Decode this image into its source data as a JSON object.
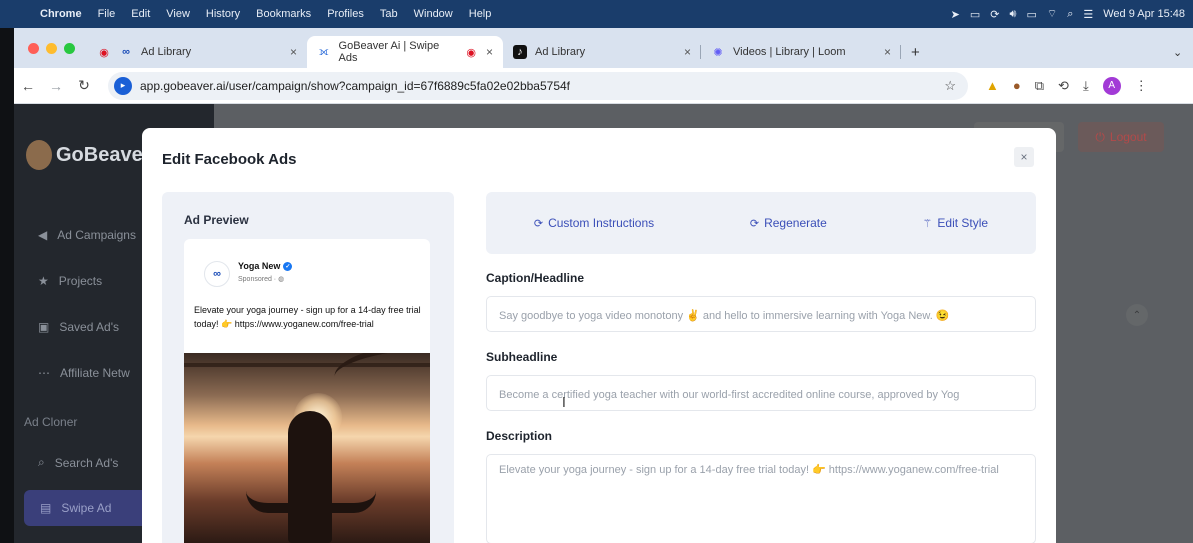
{
  "menubar": {
    "apple_icon": "apple-icon",
    "items": [
      "Chrome",
      "File",
      "Edit",
      "View",
      "History",
      "Bookmarks",
      "Profiles",
      "Tab",
      "Window",
      "Help"
    ],
    "clock": "Wed 9 Apr  15:48"
  },
  "tabs": [
    {
      "label": "Ad Library",
      "icon": "meta-icon"
    },
    {
      "label": "GoBeaver Ai | Swipe Ads",
      "icon": "gobeaver-icon"
    },
    {
      "label": "Ad Library",
      "icon": "tiktok-icon"
    },
    {
      "label": "Videos | Library | Loom",
      "icon": "loom-icon"
    }
  ],
  "address": {
    "url": "app.gobeaver.ai/user/campaign/show?campaign_id=67f6889c5fa02e02bba5754f",
    "avatar_letter": "A"
  },
  "sidebar": {
    "logo": "GoBeave",
    "items": [
      "Ad Campaigns",
      "Projects",
      "Saved Ad's",
      "Affiliate Netw"
    ],
    "section": "Ad Cloner",
    "cloner_items": [
      "Search Ad's",
      "Swipe Ad"
    ]
  },
  "header": {
    "logout": "Logout"
  },
  "modal": {
    "title": "Edit Facebook Ads",
    "close": "×",
    "preview": {
      "title": "Ad Preview",
      "page_name": "Yoga New",
      "sponsored": "Sponsored · ",
      "text": "Elevate your yoga journey - sign up for a 14-day free trial today! 👉 https://www.yoganew.com/free-trial"
    },
    "actions": {
      "custom": "Custom Instructions",
      "regenerate": "Regenerate",
      "edit_style": "Edit Style"
    },
    "fields": {
      "caption_label": "Caption/Headline",
      "caption_value": "Say goodbye to yoga video monotony ✌️ and hello to immersive learning with Yoga New. 😉",
      "sub_label": "Subheadline",
      "sub_value": "Become a certified yoga teacher with our world-first accredited online course, approved by Yog",
      "desc_label": "Description",
      "desc_value": "Elevate your yoga journey - sign up for a 14-day free trial today! 👉 https://www.yoganew.com/free-trial"
    }
  }
}
